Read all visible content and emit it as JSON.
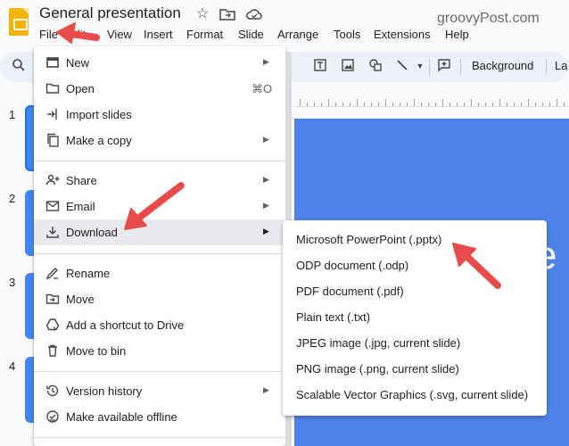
{
  "doc": {
    "title": "General presentation"
  },
  "watermark": "groovyPost.com",
  "menubar": [
    "File",
    "Edit",
    "View",
    "Insert",
    "Format",
    "Slide",
    "Arrange",
    "Tools",
    "Extensions",
    "Help"
  ],
  "toolbar": {
    "background_label": "Background",
    "layout_label": "La"
  },
  "slide_numbers": [
    "1",
    "2",
    "3",
    "4"
  ],
  "slide_partial_text": "e",
  "file_menu": {
    "items": [
      {
        "label": "New",
        "icon": "new-slides-icon",
        "arrow": true
      },
      {
        "label": "Open",
        "icon": "folder-icon",
        "shortcut": "⌘O"
      },
      {
        "label": "Import slides",
        "icon": "import-icon"
      },
      {
        "label": "Make a copy",
        "icon": "copy-icon",
        "arrow": true
      },
      {
        "label": "Share",
        "icon": "person-add-icon",
        "arrow": true
      },
      {
        "label": "Email",
        "icon": "email-icon",
        "arrow": true
      },
      {
        "label": "Download",
        "icon": "download-icon",
        "arrow": true
      },
      {
        "label": "Rename",
        "icon": "edit-icon"
      },
      {
        "label": "Move",
        "icon": "move-folder-icon"
      },
      {
        "label": "Add a shortcut to Drive",
        "icon": "drive-shortcut-icon"
      },
      {
        "label": "Move to bin",
        "icon": "trash-icon"
      },
      {
        "label": "Version history",
        "icon": "history-icon",
        "arrow": true
      },
      {
        "label": "Make available offline",
        "icon": "offline-icon"
      }
    ]
  },
  "download_submenu": {
    "items": [
      "Microsoft PowerPoint (.pptx)",
      "ODP document (.odp)",
      "PDF document (.pdf)",
      "Plain text (.txt)",
      "JPEG image (.jpg, current slide)",
      "PNG image (.png, current slide)",
      "Scalable Vector Graphics (.svg, current slide)"
    ]
  },
  "colors": {
    "accent": "#1a73e8",
    "slide": "#4e82ea",
    "logo": "#f4b400",
    "annotation_arrow": "#e94b4b"
  }
}
